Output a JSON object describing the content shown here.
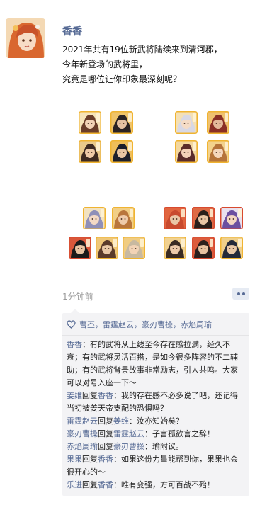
{
  "post": {
    "username": "香香",
    "text_lines": [
      "2021年共有19位新武将陆续来到清河郡，",
      "今年新登场的武将里，",
      "究竟是哪位让你印象最深刻呢？"
    ],
    "time": "1分钟前"
  },
  "likes": {
    "names": "曹丕，雷霆赵云，豪刃曹操，赤焰周瑜"
  },
  "comments": [
    {
      "from": "香香",
      "to": "",
      "text": "有的武将从上线至今存在感拉满，经久不衰；有的武将灵活百搭，是如今很多阵容的不二辅助；有的武将背景故事非常励志，引人共鸣。大家可以对号入座一下～"
    },
    {
      "from": "姜维",
      "to": "香香",
      "text": "我的存在感不必多说了吧，还记得当初被姜天帝支配的恐惧吗？"
    },
    {
      "from": "雷霆赵云",
      "to": "姜维",
      "text": "汝亦知始矣？"
    },
    {
      "from": "豪刃曹操",
      "to": "雷霆赵云",
      "text": "子言孤欲言之辞！"
    },
    {
      "from": "赤焰周瑜",
      "to": "豪刃曹操",
      "text": "瑜附议。"
    },
    {
      "from": "果果",
      "to": "香香",
      "text": "如果这份力量能帮到你，果果也会很开心的～"
    },
    {
      "from": "乐进",
      "to": "香香",
      "text": "唯有变强，方可百战不殆！"
    }
  ],
  "labels": {
    "reply": "回复",
    "colon": "："
  },
  "colors": {
    "name_blue": "#576b95",
    "gold_frame": "#f0b431",
    "red_frame": "#d84a2f"
  },
  "icons": {
    "like": "heart-outline-icon",
    "more": "more-dots-icon"
  },
  "photos": [
    {
      "frame": "gold",
      "hair": "#6a3d2a",
      "skin": "#f2d2b6",
      "bg": "#f7e4b8"
    },
    {
      "frame": "gold",
      "hair": "#2b2323",
      "skin": "#e7c3a3",
      "bg": "#f0c46a"
    },
    {
      "frame": "gold",
      "hair": "#3d2a22",
      "skin": "#eecaa8",
      "bg": "#e9c98b"
    },
    {
      "frame": "gold",
      "hair": "#1d1f2b",
      "skin": "#e8c6a4",
      "bg": "#efbe5a"
    },
    {
      "frame": "gold",
      "hair": "#d8d8e4",
      "skin": "#f5dcc6",
      "bg": "#f4e0b5"
    },
    {
      "frame": "gold",
      "hair": "#8a2f25",
      "skin": "#e4b99a",
      "bg": "#efc170"
    },
    {
      "frame": "gold",
      "hair": "#5a2c2a",
      "skin": "#f3d1b8",
      "bg": "#f3d79e"
    },
    {
      "frame": "gold",
      "hair": "#b5733a",
      "skin": "#f5d7bd",
      "bg": "#f3d28c"
    },
    {
      "frame": "gold",
      "hair": "#8f8fb8",
      "skin": "#f4d9c4",
      "bg": "#f2e2c0"
    },
    {
      "frame": "gold",
      "hair": "#b9763c",
      "skin": "#efcbaa",
      "bg": "#f2cf86"
    },
    {
      "frame": "red",
      "hair": "#1b1b1b",
      "skin": "#e8c4a2",
      "bg": "#d9573a"
    },
    {
      "frame": "gold",
      "hair": "#5b3b2a",
      "skin": "#e9c8a6",
      "bg": "#efc779"
    },
    {
      "frame": "gold",
      "hair": "#c8b9a0",
      "skin": "#f2d3b6",
      "bg": "#f0cc82"
    },
    {
      "frame": "red",
      "hair": "#c84a2e",
      "skin": "#eac6a6",
      "bg": "#e1653f"
    },
    {
      "frame": "red",
      "hair": "#2a1e1a",
      "skin": "#e9c5a4",
      "bg": "#de6a44"
    },
    {
      "frame": "red",
      "hair": "#6b4fa0",
      "skin": "#f3d6c2",
      "bg": "#e9e1ee"
    },
    {
      "frame": "gold",
      "hair": "#3a2b22",
      "skin": "#eccaa9",
      "bg": "#f1d190"
    },
    {
      "frame": "red",
      "hair": "#2b1f1c",
      "skin": "#e7c2a0",
      "bg": "#dc5c3c"
    },
    {
      "frame": "gold",
      "hair": "#242a3a",
      "skin": "#e9c9a8",
      "bg": "#efcf8a"
    },
    {
      "frame": "gold",
      "hair": "#4a3426",
      "skin": "#edcaa8",
      "bg": "#f0cb7e"
    }
  ]
}
